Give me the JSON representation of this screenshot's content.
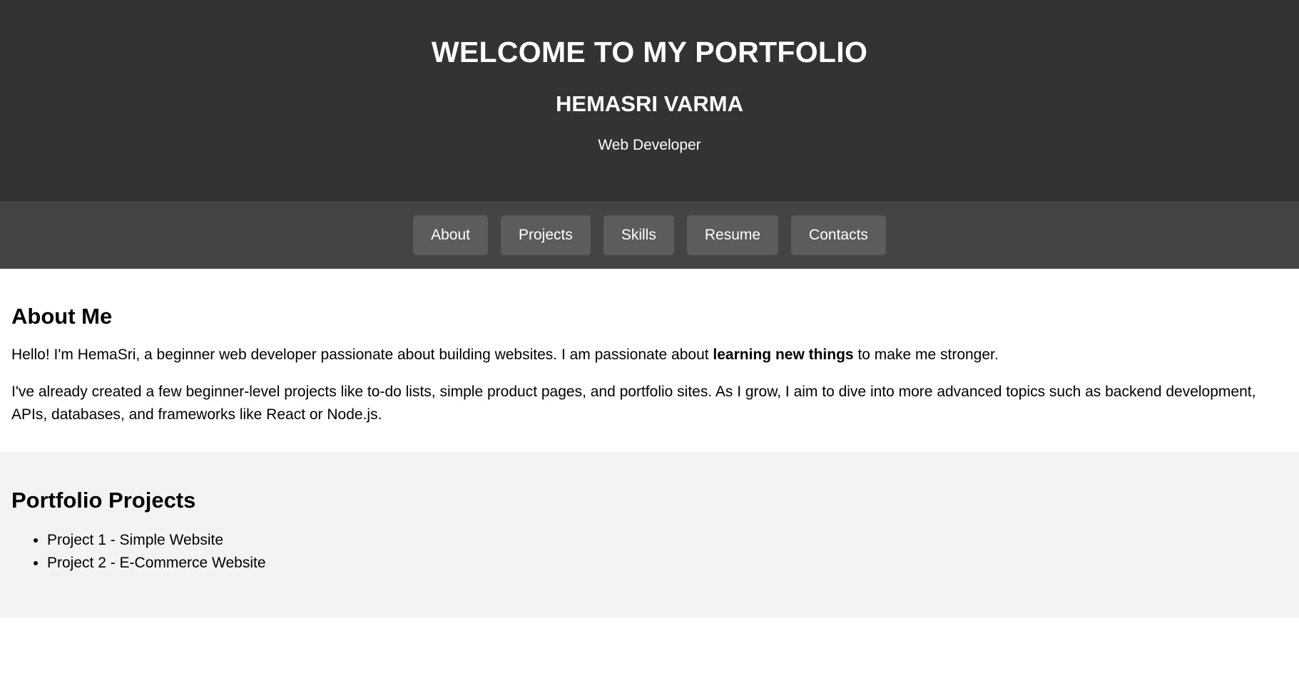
{
  "header": {
    "title": "WELCOME TO MY PORTFOLIO",
    "name": "HEMASRI VARMA",
    "role": "Web Developer"
  },
  "nav": {
    "items": [
      {
        "label": "About"
      },
      {
        "label": "Projects"
      },
      {
        "label": "Skills"
      },
      {
        "label": "Resume"
      },
      {
        "label": "Contacts"
      }
    ]
  },
  "about": {
    "heading": "About Me",
    "p1_before": "Hello! I'm HemaSri, a beginner web developer passionate about building websites. I am passionate about ",
    "p1_bold": "learning new things",
    "p1_after": " to make me stronger.",
    "p2": "I've already created a few beginner-level projects like to-do lists, simple product pages, and portfolio sites. As I grow, I aim to dive into more advanced topics such as backend development, APIs, databases, and frameworks like React or Node.js."
  },
  "projects": {
    "heading": "Portfolio Projects",
    "items": [
      {
        "label": "Project 1 - Simple Website"
      },
      {
        "label": "Project 2 - E-Commerce Website"
      }
    ]
  },
  "colors": {
    "header_bg": "#333333",
    "nav_bg": "#444444",
    "nav_button_bg": "#5c5c5c",
    "projects_bg": "#f3f3f3"
  }
}
